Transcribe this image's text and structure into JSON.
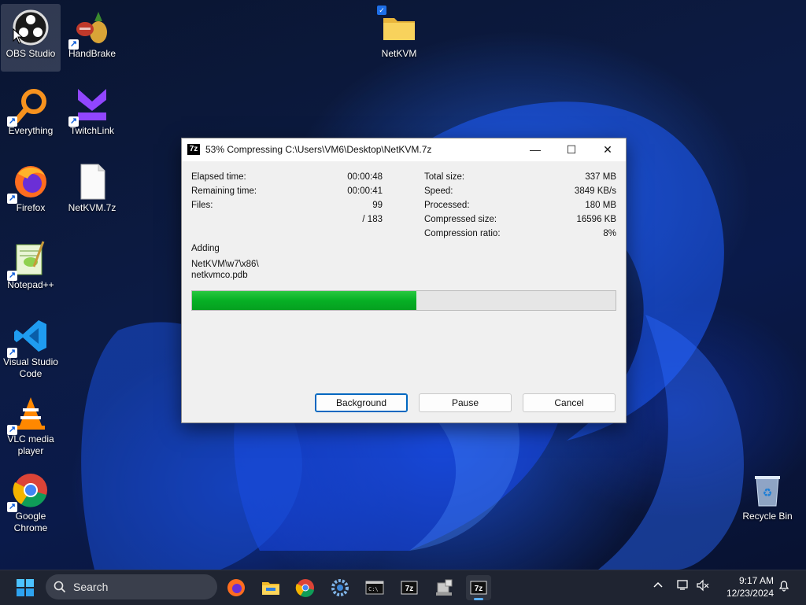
{
  "desktop": {
    "icons": [
      {
        "label": "OBS Studio"
      },
      {
        "label": "HandBrake"
      },
      {
        "label": "NetKVM"
      },
      {
        "label": "Everything"
      },
      {
        "label": "TwitchLink"
      },
      {
        "label": "Firefox"
      },
      {
        "label": "NetKVM.7z"
      },
      {
        "label": "Notepad++"
      },
      {
        "label": "Visual Studio Code"
      },
      {
        "label": "VLC media player"
      },
      {
        "label": "Google Chrome"
      },
      {
        "label": "Recycle Bin"
      }
    ]
  },
  "dialog": {
    "app_icon": "7z",
    "title": "53% Compressing C:\\Users\\VM6\\Desktop\\NetKVM.7z",
    "window_controls": {
      "minimize": "—",
      "maximize": "☐",
      "close": "✕"
    },
    "left_stats": {
      "elapsed_label": "Elapsed time:",
      "elapsed_value": "00:00:48",
      "remaining_label": "Remaining time:",
      "remaining_value": "00:00:41",
      "files_label": "Files:",
      "files_value": "99",
      "files_total": "/ 183"
    },
    "right_stats": {
      "total_size_label": "Total size:",
      "total_size_value": "337 MB",
      "speed_label": "Speed:",
      "speed_value": "3849 KB/s",
      "processed_label": "Processed:",
      "processed_value": "180 MB",
      "compressed_label": "Compressed size:",
      "compressed_value": "16596 KB",
      "ratio_label": "Compression ratio:",
      "ratio_value": "8%"
    },
    "status": {
      "action": "Adding",
      "path_line1": "NetKVM\\w7\\x86\\",
      "path_line2": "netkvmco.pdb"
    },
    "progress_percent": 53,
    "buttons": {
      "background": "Background",
      "pause": "Pause",
      "cancel": "Cancel"
    }
  },
  "taskbar": {
    "search_placeholder": "Search",
    "apps": [
      "start-icon",
      "firefox-icon",
      "file-explorer-icon",
      "chrome-icon",
      "settings-icon",
      "terminal-icon",
      "7zip-icon",
      "network-drive-icon",
      "7zip-active-icon"
    ],
    "clock_time": "9:17 AM",
    "clock_date": "12/23/2024"
  },
  "colors": {
    "accent": "#0067c0",
    "progress": "#06b025",
    "taskbar": "#1f2431"
  }
}
